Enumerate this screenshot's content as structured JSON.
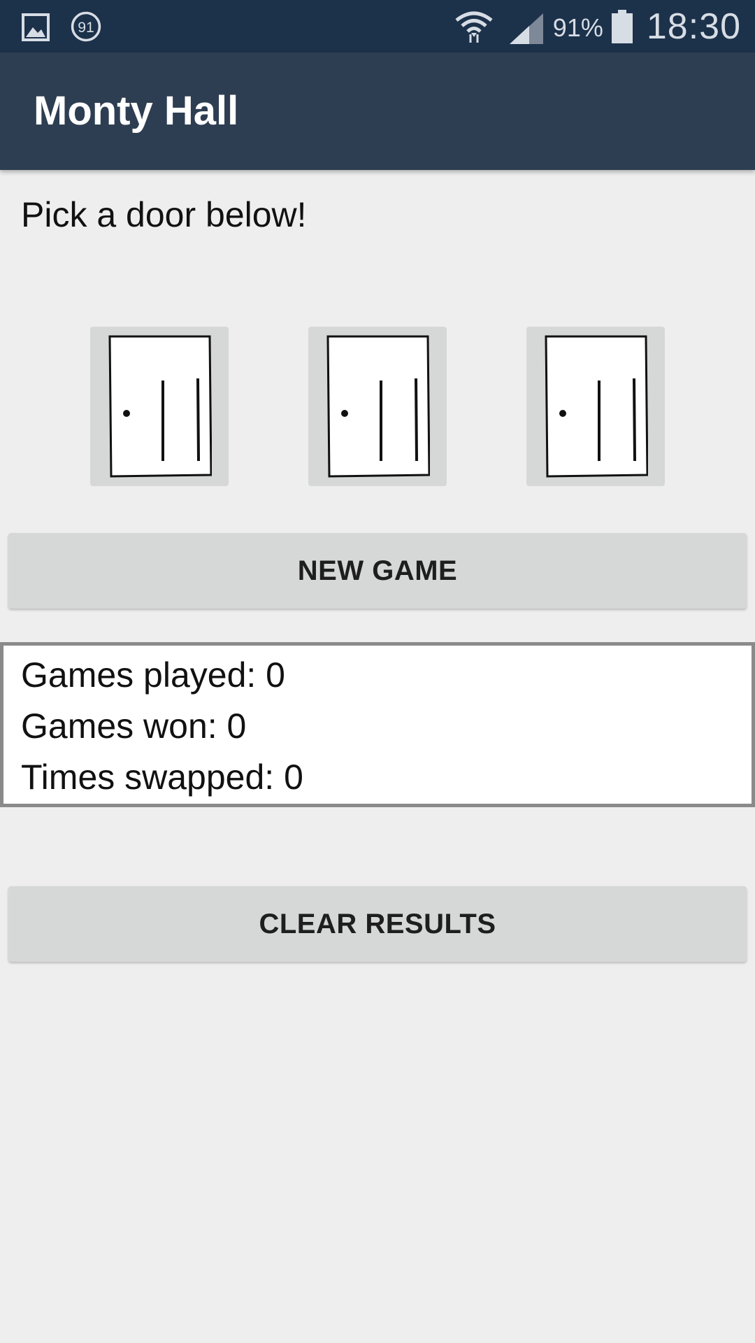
{
  "status_bar": {
    "icons_left": [
      "gallery-icon",
      "notification-count-icon"
    ],
    "notification_count": "91",
    "icons_right": [
      "wifi-icon",
      "signal-icon",
      "battery-icon"
    ],
    "battery_percent": "91%",
    "time": "18:30"
  },
  "app_bar": {
    "title": "Monty Hall"
  },
  "game": {
    "prompt": "Pick a door below!",
    "doors": [
      "door-icon",
      "door-icon",
      "door-icon"
    ]
  },
  "buttons": {
    "new_game": "NEW GAME",
    "clear_results": "CLEAR RESULTS"
  },
  "results": {
    "games_played": "Games played: 0",
    "games_won": "Games won: 0",
    "times_swapped": "Times swapped: 0"
  },
  "colors": {
    "status_bar_bg": "#1c314a",
    "app_bar_bg": "#2e3e52",
    "page_bg": "#eeeeee",
    "button_bg": "#d6d7d7",
    "results_border": "#8a8a8a"
  }
}
